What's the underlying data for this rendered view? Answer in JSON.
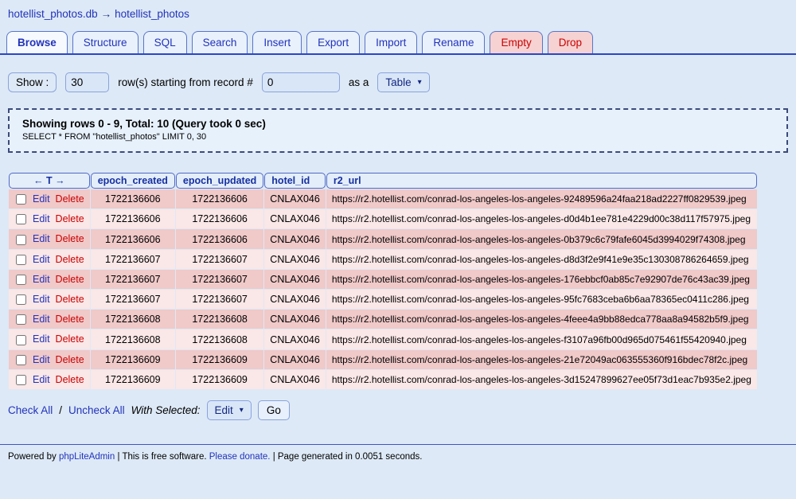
{
  "colors": {
    "page_bg": "#dde9f6",
    "link_blue": "#2233bb",
    "delete_red": "#cc0000",
    "row_odd": "#f0c9c9",
    "row_even": "#fae7e7",
    "header_bg": "#e4eefb",
    "tab_line": "#2b46c8",
    "danger_tab_bg": "#f6d2d2"
  },
  "breadcrumb": {
    "db": "hotellist_photos.db",
    "arrow": "→",
    "table": "hotellist_photos"
  },
  "tabs": [
    {
      "label": "Browse",
      "active": true
    },
    {
      "label": "Structure"
    },
    {
      "label": "SQL"
    },
    {
      "label": "Search"
    },
    {
      "label": "Insert"
    },
    {
      "label": "Export"
    },
    {
      "label": "Import"
    },
    {
      "label": "Rename"
    },
    {
      "label": "Empty",
      "danger": true
    },
    {
      "label": "Drop",
      "danger": true
    }
  ],
  "controls": {
    "show_label": "Show :",
    "rows_value": "30",
    "rows_text": "row(s) starting from record #",
    "start_value": "0",
    "as_a": "as a",
    "view_value": "Table",
    "chevron": "▾"
  },
  "query_box": {
    "summary": "Showing rows 0 - 9, Total: 10 (Query took 0 sec)",
    "sql": "SELECT * FROM \"hotellist_photos\" LIMIT 0, 30"
  },
  "table": {
    "headers": [
      "← T →",
      "epoch_created",
      "epoch_updated",
      "hotel_id",
      "r2_url"
    ],
    "row_actions": {
      "edit": "Edit",
      "delete": "Delete"
    },
    "rows": [
      {
        "epoch_created": "1722136606",
        "epoch_updated": "1722136606",
        "hotel_id": "CNLAX046",
        "r2_url": "https://r2.hotellist.com/conrad-los-angeles-los-angeles-92489596a24faa218ad2227ff0829539.jpeg"
      },
      {
        "epoch_created": "1722136606",
        "epoch_updated": "1722136606",
        "hotel_id": "CNLAX046",
        "r2_url": "https://r2.hotellist.com/conrad-los-angeles-los-angeles-d0d4b1ee781e4229d00c38d117f57975.jpeg"
      },
      {
        "epoch_created": "1722136606",
        "epoch_updated": "1722136606",
        "hotel_id": "CNLAX046",
        "r2_url": "https://r2.hotellist.com/conrad-los-angeles-los-angeles-0b379c6c79fafe6045d3994029f74308.jpeg"
      },
      {
        "epoch_created": "1722136607",
        "epoch_updated": "1722136607",
        "hotel_id": "CNLAX046",
        "r2_url": "https://r2.hotellist.com/conrad-los-angeles-los-angeles-d8d3f2e9f41e9e35c130308786264659.jpeg"
      },
      {
        "epoch_created": "1722136607",
        "epoch_updated": "1722136607",
        "hotel_id": "CNLAX046",
        "r2_url": "https://r2.hotellist.com/conrad-los-angeles-los-angeles-176ebbcf0ab85c7e92907de76c43ac39.jpeg"
      },
      {
        "epoch_created": "1722136607",
        "epoch_updated": "1722136607",
        "hotel_id": "CNLAX046",
        "r2_url": "https://r2.hotellist.com/conrad-los-angeles-los-angeles-95fc7683ceba6b6aa78365ec0411c286.jpeg"
      },
      {
        "epoch_created": "1722136608",
        "epoch_updated": "1722136608",
        "hotel_id": "CNLAX046",
        "r2_url": "https://r2.hotellist.com/conrad-los-angeles-los-angeles-4feee4a9bb88edca778aa8a94582b5f9.jpeg"
      },
      {
        "epoch_created": "1722136608",
        "epoch_updated": "1722136608",
        "hotel_id": "CNLAX046",
        "r2_url": "https://r2.hotellist.com/conrad-los-angeles-los-angeles-f3107a96fb00d965d075461f55420940.jpeg"
      },
      {
        "epoch_created": "1722136609",
        "epoch_updated": "1722136609",
        "hotel_id": "CNLAX046",
        "r2_url": "https://r2.hotellist.com/conrad-los-angeles-los-angeles-21e72049ac063555360f916bdec78f2c.jpeg"
      },
      {
        "epoch_created": "1722136609",
        "epoch_updated": "1722136609",
        "hotel_id": "CNLAX046",
        "r2_url": "https://r2.hotellist.com/conrad-los-angeles-los-angeles-3d15247899627ee05f73d1eac7b935e2.jpeg"
      }
    ]
  },
  "bottom": {
    "check_all": "Check All",
    "separator": "/",
    "uncheck_all": "Uncheck All",
    "with_selected": "With Selected:",
    "action_value": "Edit",
    "chevron": "▾",
    "go": "Go"
  },
  "footer": {
    "powered": "Powered by",
    "app": "phpLiteAdmin",
    "free_text": "| This is free software.",
    "donate": "Please donate.",
    "generated": "| Page generated in 0.0051 seconds."
  }
}
